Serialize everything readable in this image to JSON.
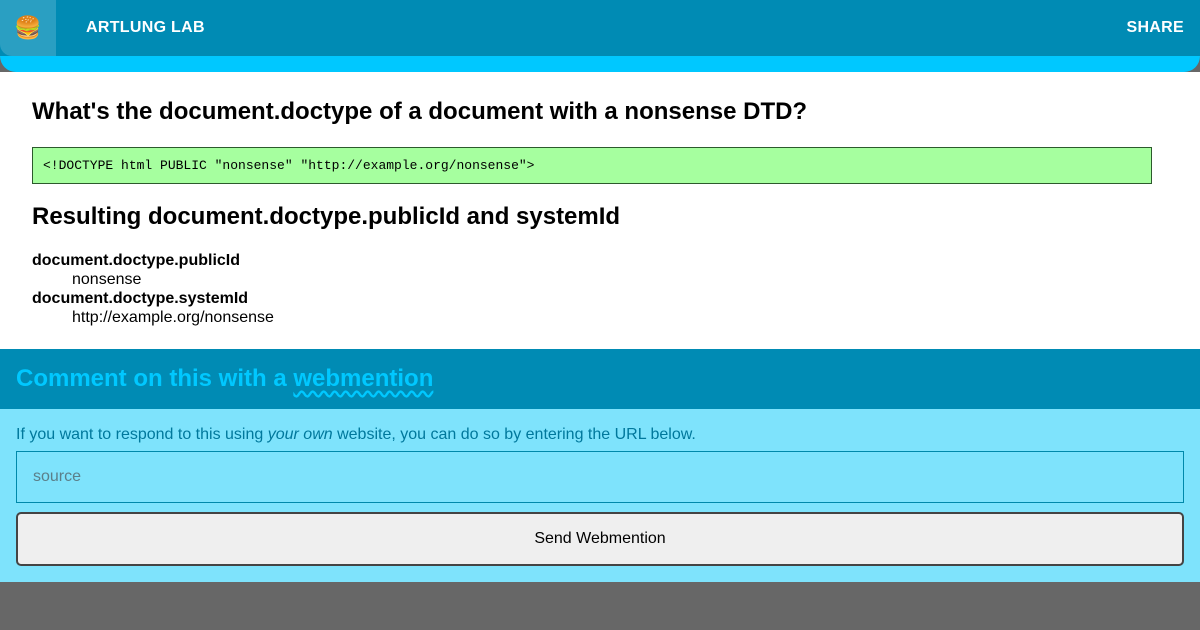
{
  "header": {
    "menu_icon": "🍔",
    "site_title": "ARTLUNG LAB",
    "share_label": "SHARE"
  },
  "article": {
    "title": "What's the document.doctype of a document with a nonsense DTD?",
    "code": "<!DOCTYPE html PUBLIC \"nonsense\" \"http://example.org/nonsense\">",
    "result_heading": "Resulting document.doctype.publicId and systemId",
    "results": [
      {
        "term": "document.doctype.publicId",
        "value": "nonsense"
      },
      {
        "term": "document.doctype.systemId",
        "value": "http://example.org/nonsense"
      }
    ]
  },
  "comments": {
    "heading_prefix": "Comment on this with a",
    "heading_link": "webmention",
    "hint_prefix": "If you want to respond to this using",
    "hint_emphasis": "your own",
    "hint_suffix": "website, you can do so by entering the URL below.",
    "input_placeholder": "source",
    "submit_label": "Send Webmention"
  },
  "colors": {
    "header_bar": "#008bb4",
    "accent": "#00c8ff",
    "code_bg": "#a6ff9f",
    "comments_bg": "#7ee3fc",
    "footer_bg": "#676767"
  }
}
